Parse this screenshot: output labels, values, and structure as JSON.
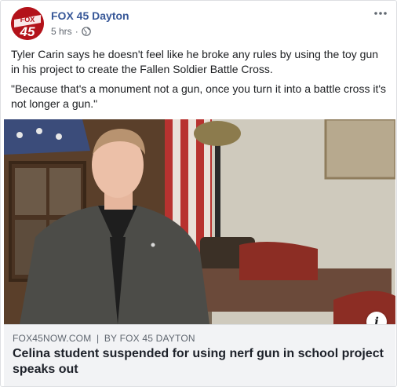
{
  "post": {
    "page_name": "FOX 45 Dayton",
    "timestamp": "5 hrs",
    "separator": "·",
    "privacy_icon": "globe-icon",
    "more_icon": "more-options-icon",
    "avatar_text": "45",
    "avatar_brand": "FOX",
    "text_paragraphs": [
      "Tyler Carin says he doesn't feel like he broke any rules by using the toy gun in his project to create the Fallen Soldier Battle Cross.",
      "\"Because that's a monument not a gun, once you turn it into a battle cross it's not longer a gun.\""
    ]
  },
  "link": {
    "source": "FOX45NOW.COM",
    "divider": "|",
    "byline": "BY FOX 45 DAYTON",
    "title": "Celina student suspended for using nerf gun in school project speaks out",
    "info_icon": "info-icon",
    "info_label": "i"
  },
  "colors": {
    "page_name": "#385898",
    "meta": "#616770",
    "link_bg": "#f2f3f5",
    "avatar_red": "#b3121a"
  }
}
